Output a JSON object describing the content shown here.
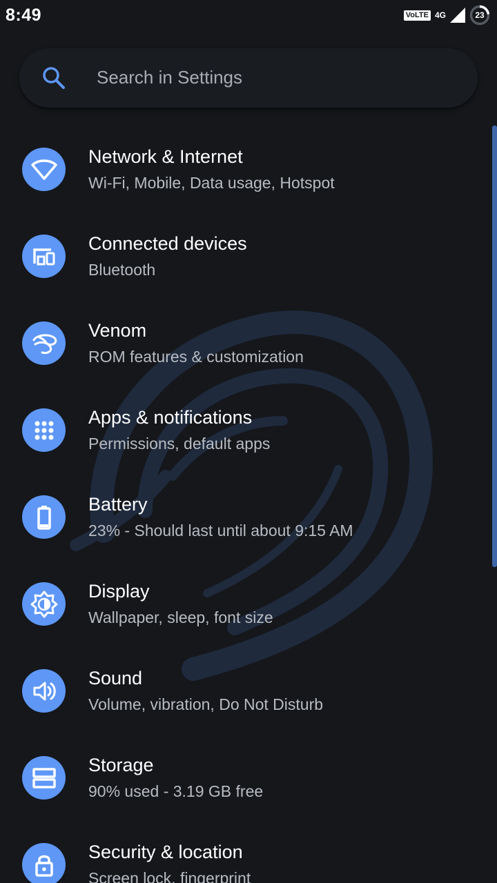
{
  "status_bar": {
    "time": "8:49",
    "volte": "VoLTE",
    "network_type": "4G",
    "battery_level": "23",
    "battery_fraction": 0.23
  },
  "search": {
    "placeholder": "Search in Settings"
  },
  "colors": {
    "background": "#15171b",
    "accent_icon": "#5e97f6",
    "scrollbar": "#3f67a8"
  },
  "settings": [
    {
      "icon": "wifi-icon",
      "title": "Network & Internet",
      "summary": "Wi-Fi, Mobile, Data usage, Hotspot"
    },
    {
      "icon": "devices-icon",
      "title": "Connected devices",
      "summary": "Bluetooth"
    },
    {
      "icon": "venom-icon",
      "title": "Venom",
      "summary": "ROM features & customization"
    },
    {
      "icon": "apps-grid-icon",
      "title": "Apps & notifications",
      "summary": "Permissions, default apps"
    },
    {
      "icon": "battery-icon",
      "title": "Battery",
      "summary": "23% - Should last until about 9:15 AM"
    },
    {
      "icon": "brightness-icon",
      "title": "Display",
      "summary": "Wallpaper, sleep, font size"
    },
    {
      "icon": "volume-icon",
      "title": "Sound",
      "summary": "Volume, vibration, Do Not Disturb"
    },
    {
      "icon": "storage-icon",
      "title": "Storage",
      "summary": "90% used - 3.19 GB free"
    },
    {
      "icon": "lock-icon",
      "title": "Security & location",
      "summary": "Screen lock, fingerprint"
    }
  ]
}
